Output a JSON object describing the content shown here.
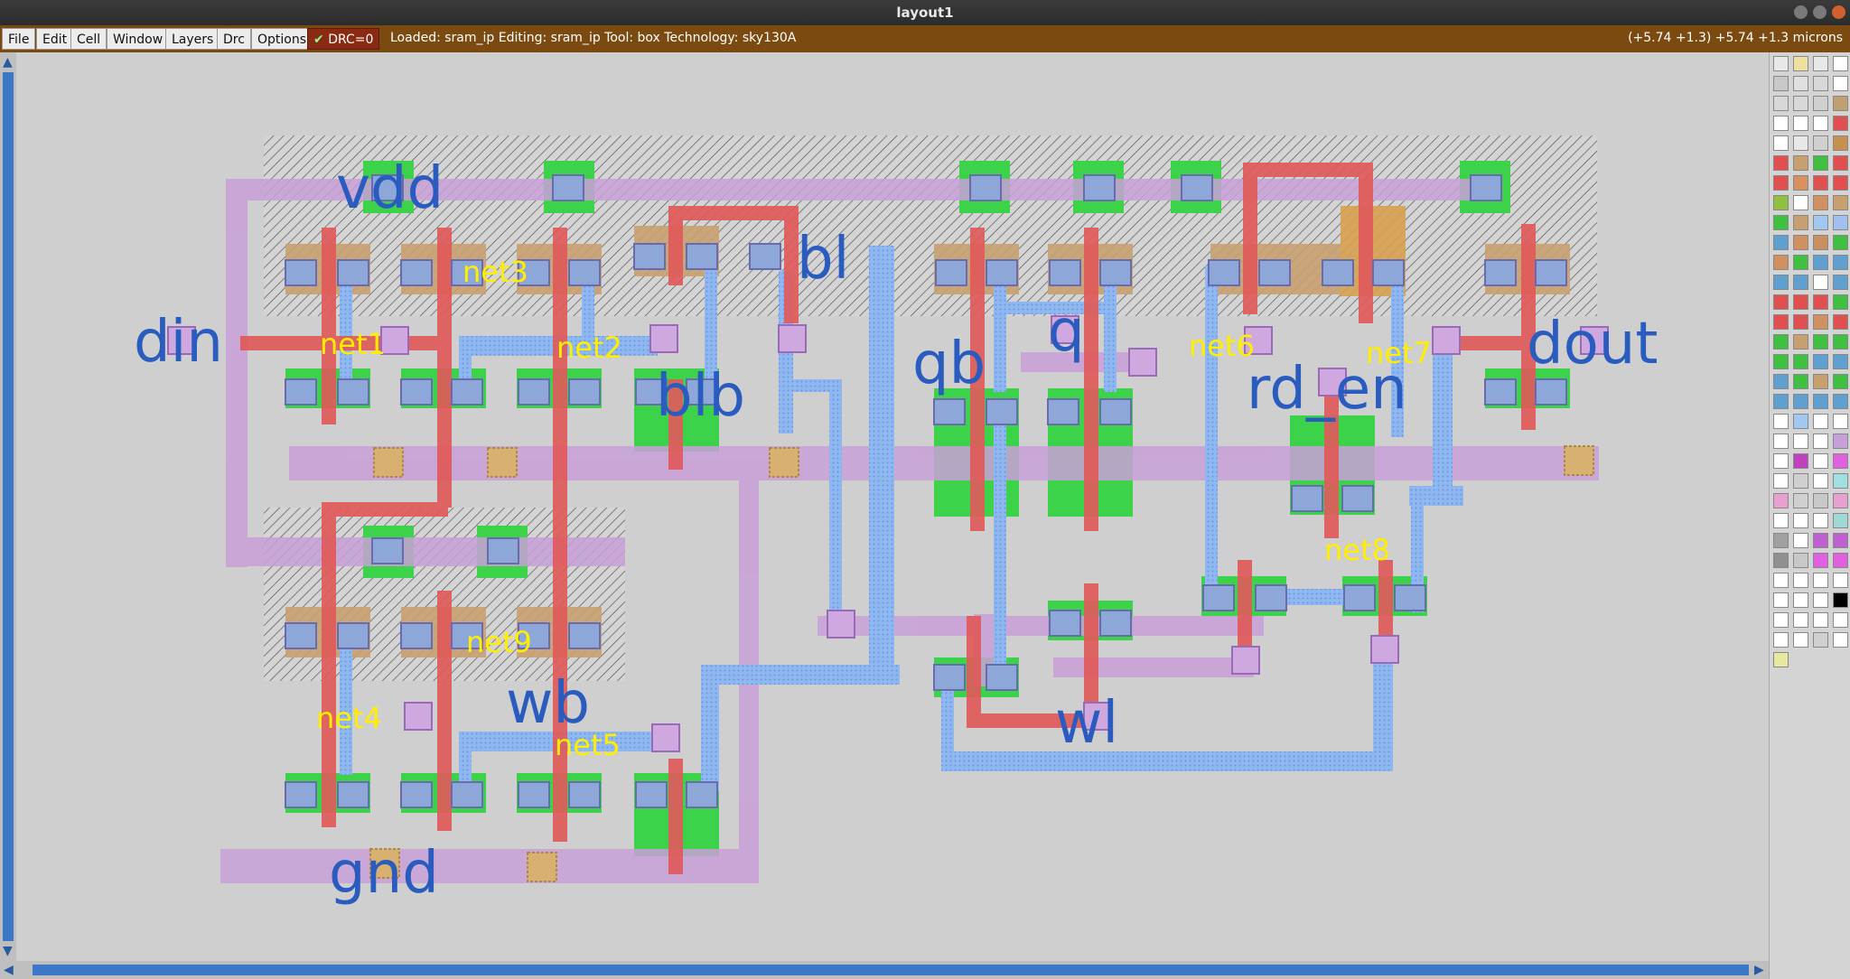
{
  "window": {
    "title": "layout1"
  },
  "menu": {
    "file": "File",
    "edit": "Edit",
    "cell": "Cell",
    "window": "Window",
    "layers": "Layers",
    "drc": "Drc",
    "options": "Options",
    "drc_status": "DRC=0"
  },
  "status": {
    "text": "Loaded: sram_ip Editing: sram_ip Tool: box  Technology: sky130A",
    "coords": "(+5.74 +1.3) +5.74 +1.3 microns"
  },
  "labels": {
    "vdd": "vdd",
    "din": "din",
    "gnd": "gnd",
    "blb": "blb",
    "bl": "bl",
    "qb": "qb",
    "q": "q",
    "wl": "wl",
    "wb": "wb",
    "dout": "dout",
    "rd_en": "rd_en",
    "net1": "net1",
    "net2": "net2",
    "net3": "net3",
    "net4": "net4",
    "net5": "net5",
    "net6": "net6",
    "net7": "net7",
    "net8": "net8",
    "net9": "net9"
  },
  "colors": {
    "accent_menubar": "#7b4a11",
    "poly": "#e05a5a",
    "metal1": "#c8a0d8",
    "local_interconnect": "#90b8f0",
    "diffusion": "#3cd24a",
    "pin_label": "#2a5cc0",
    "net_label": "#ffee00"
  },
  "palette": [
    "#e8e8e8",
    "#f0e0a0",
    "#e8e8e8",
    "#ffffff",
    "#c8c8c8",
    "#e0e0e0",
    "#d8d8d8",
    "#ffffff",
    "#d8d8d8",
    "#d8d8d8",
    "#d0d0d0",
    "#c0a070",
    "#ffffff",
    "#ffffff",
    "#ffffff",
    "#e05050",
    "#ffffff",
    "#e8e8e8",
    "#d0d0d0",
    "#c89050",
    "#e05050",
    "#c8a070",
    "#40c040",
    "#e05050",
    "#e05050",
    "#d89060",
    "#e05050",
    "#e05050",
    "#90c040",
    "#ffffff",
    "#d09060",
    "#c8a070",
    "#40c040",
    "#c8a070",
    "#a0c8f0",
    "#a0c0f0",
    "#60a0d0",
    "#d09060",
    "#c89060",
    "#40c040",
    "#d09060",
    "#40c040",
    "#60a0d0",
    "#60a0d0",
    "#60a0d0",
    "#60a0d0",
    "#ffffff",
    "#60a0d0",
    "#e05050",
    "#e05050",
    "#e05050",
    "#40c040",
    "#e05050",
    "#e05050",
    "#d09060",
    "#e05050",
    "#40c040",
    "#c8a070",
    "#40c040",
    "#40c040",
    "#40c040",
    "#40c040",
    "#60a0d0",
    "#60a0d0",
    "#60a0d0",
    "#40c040",
    "#c8a070",
    "#40c040",
    "#60a0d0",
    "#60a0d0",
    "#60a0d0",
    "#60a0d0",
    "#ffffff",
    "#a0c8f0",
    "#ffffff",
    "#ffffff",
    "#ffffff",
    "#ffffff",
    "#ffffff",
    "#c8a0d8",
    "#ffffff",
    "#c040c0",
    "#ffffff",
    "#e060e0",
    "#ffffff",
    "#d0d0d0",
    "#ffffff",
    "#a0e0e0",
    "#e8a0d0",
    "#d0d0d0",
    "#c8c8c8",
    "#e8a0d0",
    "#ffffff",
    "#ffffff",
    "#ffffff",
    "#a0d8d8",
    "#a0a0a0",
    "#ffffff",
    "#c060d0",
    "#c060d0",
    "#909090",
    "#c8c8c8",
    "#e060e0",
    "#e060e0",
    "#ffffff",
    "#ffffff",
    "#ffffff",
    "#ffffff",
    "#ffffff",
    "#ffffff",
    "#ffffff",
    "#000000",
    "#ffffff",
    "#ffffff",
    "#ffffff",
    "#ffffff",
    "#ffffff",
    "#ffffff",
    "#d0d0d0",
    "#ffffff",
    "#e8e8a0"
  ]
}
